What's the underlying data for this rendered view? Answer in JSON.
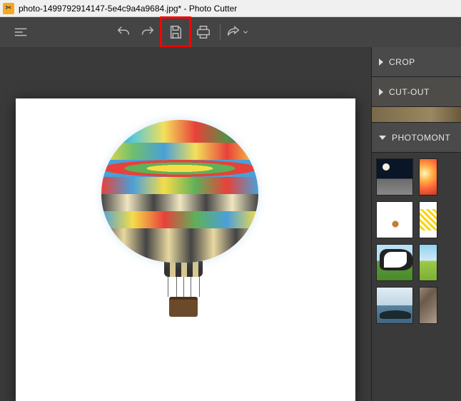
{
  "titlebar": {
    "icon_glyph": "✂",
    "text": "photo-1499792914147-5e4c9a4a9684.jpg* - Photo Cutter"
  },
  "toolbar": {
    "menu": "menu-icon",
    "undo": "undo-icon",
    "redo": "redo-icon",
    "save": "save-icon",
    "print": "print-icon",
    "share": "share-icon"
  },
  "sidebar": {
    "panels": [
      {
        "label": "CROP",
        "expanded": false
      },
      {
        "label": "CUT-OUT",
        "expanded": false
      },
      {
        "label": "PHOTOMONT",
        "expanded": true
      }
    ],
    "thumbnails": [
      {
        "name": "moon-surface"
      },
      {
        "name": "sunset-burst"
      },
      {
        "name": "cats-white"
      },
      {
        "name": "yellow-splash"
      },
      {
        "name": "cow-field"
      },
      {
        "name": "green-field"
      },
      {
        "name": "venice-gondolas"
      },
      {
        "name": "rock-texture"
      }
    ]
  },
  "canvas": {
    "subject": "hot-air-balloon"
  }
}
